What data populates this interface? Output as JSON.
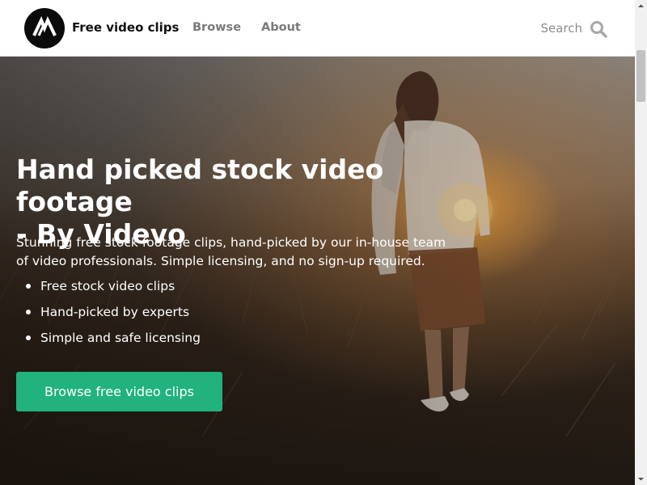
{
  "header": {
    "brand_label": "Free video clips",
    "nav": {
      "browse_label": "Browse",
      "about_label": "About"
    },
    "search": {
      "placeholder": "Search",
      "icon": "search-icon"
    },
    "logo_icon": "videvo-logo-icon"
  },
  "hero": {
    "title_line1": "Hand picked stock video footage",
    "title_line2": "- By Videvo",
    "description_line1": "Stunning free stock footage clips, hand-picked by our in-house team",
    "description_line2": "of video professionals. Simple licensing, and no sign-up required.",
    "features": [
      "Free stock video clips",
      "Hand-picked by experts",
      "Simple and safe licensing"
    ],
    "cta_label": "Browse free video clips"
  },
  "colors": {
    "accent": "#21b27e",
    "header_bg": "#ffffff",
    "nav_text": "#7a7a7a",
    "brand_text": "#111111"
  }
}
